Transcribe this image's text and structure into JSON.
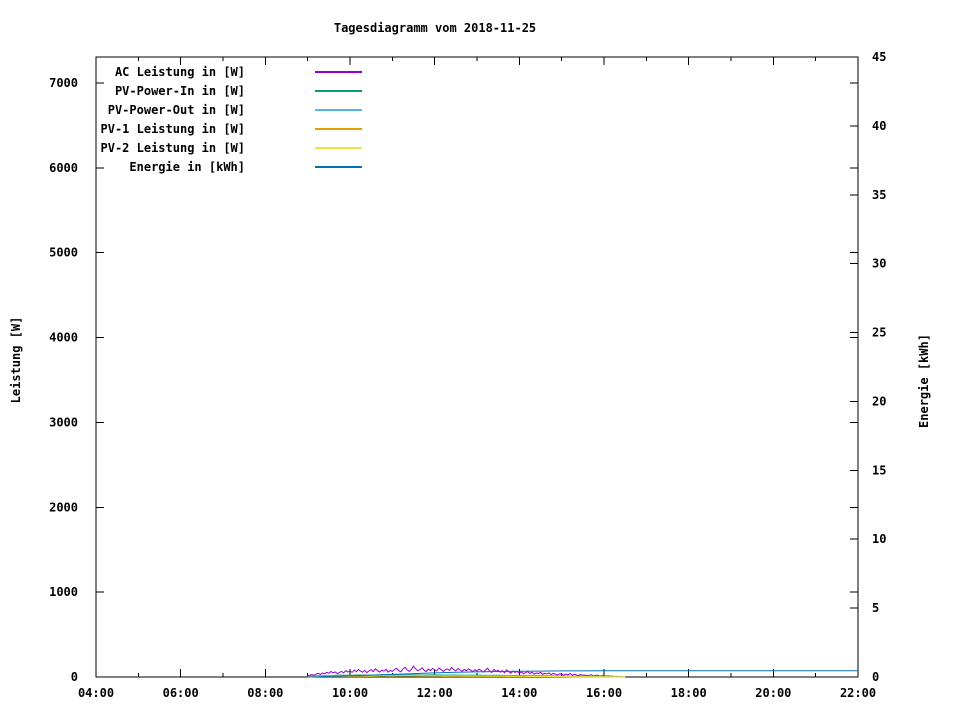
{
  "title": "Tagesdiagramm vom 2018-11-25",
  "chart_data": {
    "type": "line",
    "title": "Tagesdiagramm vom 2018-11-25",
    "background": "#ffffff",
    "border_color": "#000000",
    "grid": false,
    "legend_position": "top-left-inside",
    "x_axis": {
      "label": "",
      "range": [
        4,
        22
      ],
      "major_hours": [
        4,
        6,
        8,
        10,
        12,
        14,
        16,
        18,
        20,
        22
      ],
      "minor_hours": [
        5,
        7,
        9,
        11,
        13,
        15,
        17,
        19,
        21
      ],
      "tick_labels": [
        "04:00",
        "06:00",
        "08:00",
        "10:00",
        "12:00",
        "14:00",
        "16:00",
        "18:00",
        "20:00",
        "22:00"
      ]
    },
    "y1_axis": {
      "label": "Leistung [W]",
      "range": [
        0,
        7306
      ],
      "ticks": [
        0,
        1000,
        2000,
        3000,
        4000,
        5000,
        6000,
        7000
      ]
    },
    "y2_axis": {
      "label": "Energie [kWh]",
      "range": [
        0,
        45
      ],
      "ticks": [
        0,
        5,
        10,
        15,
        20,
        25,
        30,
        35,
        40,
        45
      ]
    },
    "series": [
      {
        "name": "AC Leistung in [W]",
        "color": "#9400d3",
        "axis": "y1",
        "start": 9.0,
        "step": 0.05,
        "values": [
          15,
          22,
          28,
          20,
          34,
          42,
          30,
          48,
          38,
          55,
          44,
          65,
          50,
          60,
          40,
          54,
          66,
          48,
          74,
          58,
          70,
          54,
          82,
          62,
          90,
          68,
          56,
          78,
          52,
          72,
          86,
          64,
          96,
          74,
          58,
          80,
          68,
          90,
          56,
          78,
          66,
          88,
          102,
          76,
          60,
          92,
          115,
          84,
          66,
          90,
          128,
          96,
          74,
          86,
          108,
          80,
          64,
          92,
          76,
          100,
          86,
          72,
          106,
          90,
          66,
          84,
          96,
          78,
          112,
          88,
          72,
          100,
          82,
          66,
          90,
          74,
          96,
          80,
          62,
          86,
          68,
          92,
          76,
          58,
          82,
          104,
          70,
          54,
          88,
          66,
          80,
          56,
          74,
          48,
          84,
          62,
          44,
          70,
          54,
          66,
          46,
          60,
          38,
          52,
          64,
          42,
          56,
          34,
          48,
          40,
          54,
          32,
          44,
          36,
          50,
          28,
          42,
          34,
          24,
          38,
          30,
          22,
          34,
          26,
          40,
          20,
          32,
          24,
          16,
          28,
          20,
          24,
          14,
          20,
          26,
          12,
          18,
          22,
          10,
          14,
          16,
          10,
          13,
          8,
          11,
          6,
          9,
          5,
          7,
          4
        ]
      },
      {
        "name": "PV-Power-In in [W]",
        "color": "#009e73",
        "axis": "y1",
        "start": 9.0,
        "step": 0.25,
        "values": [
          8,
          14,
          18,
          22,
          20,
          24,
          22,
          26,
          24,
          28,
          26,
          24,
          26,
          22,
          24,
          20,
          22,
          19,
          21,
          17,
          19,
          15,
          16,
          13,
          11,
          9,
          8,
          6,
          5,
          4,
          3
        ]
      },
      {
        "name": "PV-Power-Out in [W]",
        "color": "#56b4e9",
        "axis": "y1",
        "start": 9.0,
        "step": 0.25,
        "values": [
          6,
          11,
          14,
          17,
          16,
          19,
          17,
          21,
          19,
          22,
          20,
          19,
          20,
          17,
          19,
          16,
          17,
          14,
          15,
          12,
          13,
          10,
          11,
          9,
          8,
          6,
          5,
          4,
          3,
          3,
          2
        ]
      },
      {
        "name": "PV-1 Leistung in [W]",
        "color": "#e69f00",
        "axis": "y1",
        "start": 9.0,
        "step": 0.25,
        "values": [
          4,
          7,
          9,
          11,
          10,
          12,
          11,
          13,
          12,
          14,
          13,
          12,
          13,
          11,
          12,
          10,
          11,
          9,
          10,
          8,
          9,
          7,
          8,
          6,
          5,
          4,
          4,
          3,
          2,
          2,
          1
        ]
      },
      {
        "name": "PV-2 Leistung in [W]",
        "color": "#f0e442",
        "axis": "y1",
        "start": 9.0,
        "step": 0.25,
        "values": [
          4,
          6,
          8,
          10,
          10,
          11,
          10,
          12,
          11,
          13,
          12,
          11,
          12,
          10,
          11,
          9,
          10,
          8,
          9,
          7,
          8,
          6,
          7,
          5,
          5,
          4,
          3,
          2,
          2,
          1,
          1
        ]
      },
      {
        "name": "Energie in [kWh]",
        "color": "#0072b2",
        "axis": "y2",
        "points": [
          [
            9.0,
            0
          ],
          [
            9.5,
            0.04
          ],
          [
            10,
            0.09
          ],
          [
            10.5,
            0.14
          ],
          [
            11,
            0.19
          ],
          [
            11.5,
            0.25
          ],
          [
            12,
            0.3
          ],
          [
            12.5,
            0.34
          ],
          [
            13,
            0.37
          ],
          [
            13.5,
            0.4
          ],
          [
            14,
            0.42
          ],
          [
            14.5,
            0.43
          ],
          [
            15,
            0.44
          ],
          [
            15.5,
            0.445
          ],
          [
            16,
            0.45
          ],
          [
            16.45,
            0.45
          ],
          [
            22,
            0.45
          ]
        ]
      }
    ]
  }
}
